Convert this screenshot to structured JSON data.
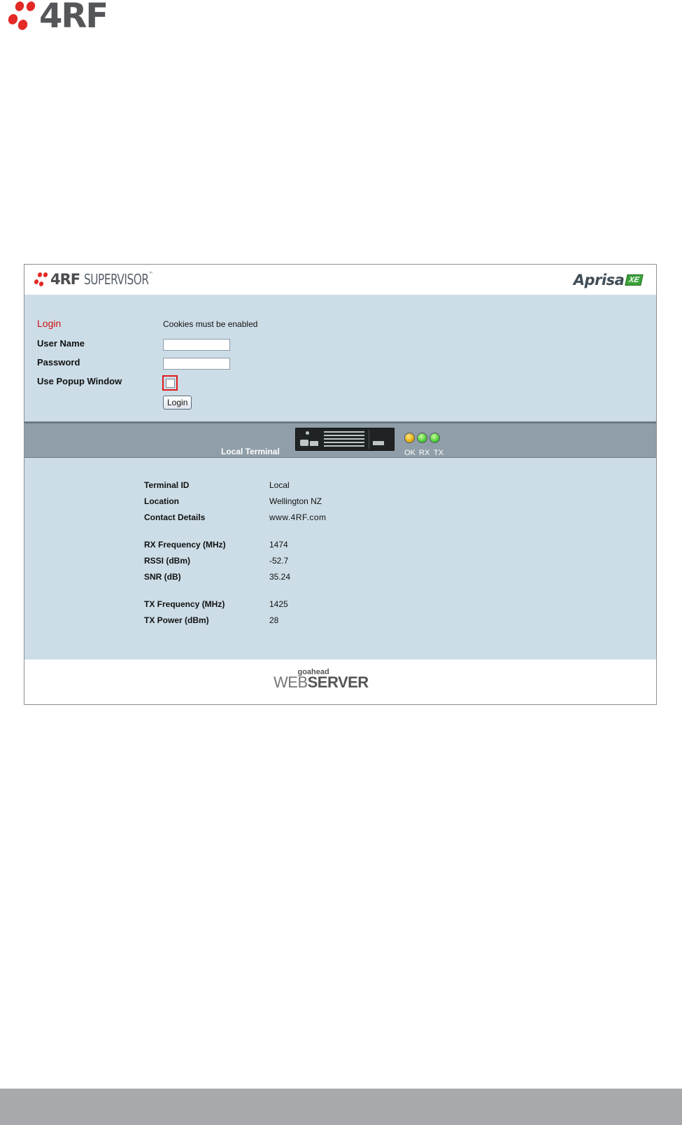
{
  "doc_logo": {
    "text": "4RF"
  },
  "header": {
    "brand": "4RF",
    "product": "SUPERVISOR",
    "trademark": "™",
    "right_brand": "Aprisa",
    "right_badge": "XE"
  },
  "login": {
    "title": "Login",
    "cookie_note": "Cookies must be enabled",
    "username_label": "User Name",
    "password_label": "Password",
    "popup_label": "Use Popup Window",
    "username_value": "",
    "password_value": "",
    "popup_checked": false,
    "button_label": "Login"
  },
  "terminal": {
    "title": "Local Terminal",
    "leds": [
      {
        "label": "OK",
        "color": "#e0a800"
      },
      {
        "label": "RX",
        "color": "#3cc22b"
      },
      {
        "label": "TX",
        "color": "#3cc22b"
      }
    ]
  },
  "info": {
    "groups": [
      [
        {
          "label": "Terminal ID",
          "value": "Local"
        },
        {
          "label": "Location",
          "value": "Wellington NZ"
        },
        {
          "label": "Contact Details",
          "value": "www.4RF.com"
        }
      ],
      [
        {
          "label": "RX Frequency (MHz)",
          "value": "1474"
        },
        {
          "label": "RSSI (dBm)",
          "value": "-52.7"
        },
        {
          "label": "SNR (dB)",
          "value": "35.24"
        }
      ],
      [
        {
          "label": "TX Frequency (MHz)",
          "value": "1425"
        },
        {
          "label": "TX Power (dBm)",
          "value": "28"
        }
      ]
    ]
  },
  "footer": {
    "small": "goahead",
    "web": "WEB",
    "server": "SERVER"
  },
  "colors": {
    "accent_red": "#e32a27",
    "panel_bg": "#ccdde7",
    "bar_bg": "#8f9ea8"
  }
}
